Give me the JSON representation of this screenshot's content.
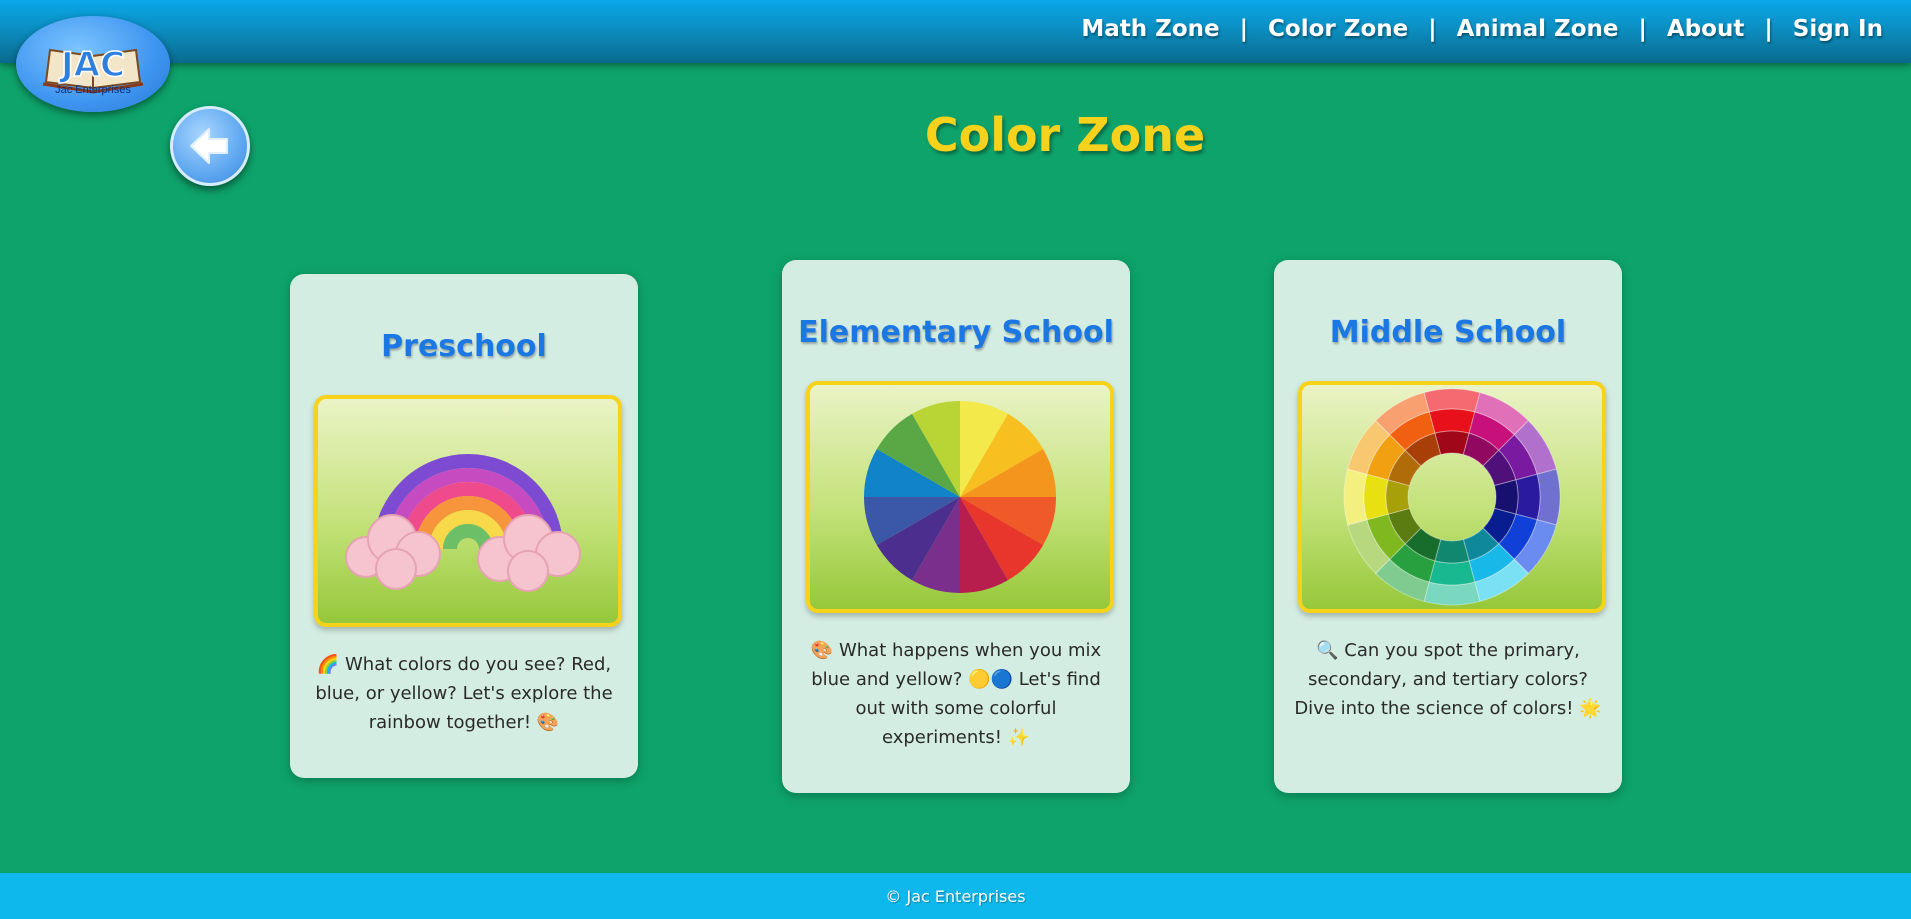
{
  "brand": {
    "logo_letters": "JAC",
    "logo_subtitle": "Jac Enterprises"
  },
  "nav": {
    "items": [
      "Math Zone",
      "Color Zone",
      "Animal Zone",
      "About",
      "Sign In"
    ],
    "separator": "|"
  },
  "page": {
    "title": "Color Zone"
  },
  "cards": [
    {
      "title": "Preschool",
      "image": "rainbow-with-clouds",
      "description": "🌈 What colors do you see? Red, blue, or yellow? Let's explore the rainbow together! 🎨"
    },
    {
      "title": "Elementary School",
      "image": "color-wheel",
      "description": "🎨 What happens when you mix blue and yellow? 🟡🔵 Let's find out with some colorful experiments! ✨"
    },
    {
      "title": "Middle School",
      "image": "tint-shade-color-ring",
      "description": "🔍 Can you spot the primary, secondary, and tertiary colors? Dive into the science of colors! 🌟"
    }
  ],
  "footer": {
    "copyright": "© Jac Enterprises"
  },
  "colors": {
    "background": "#0ea36b",
    "header": "#0b8fc2",
    "footer": "#0fb8ec",
    "title": "#f7d21c",
    "card_title": "#1a77e3",
    "card_background": "#d4ede3",
    "frame_border": "#f6d21a"
  },
  "icons": {
    "back": "arrow-left-icon"
  }
}
